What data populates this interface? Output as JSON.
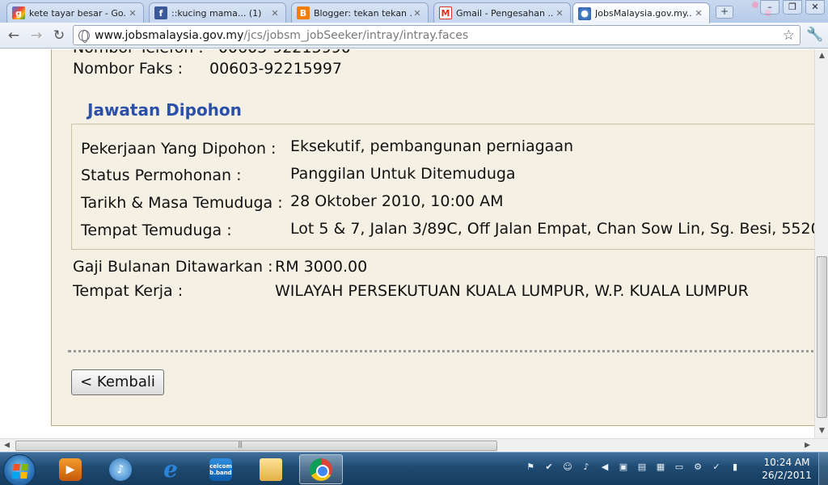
{
  "browser": {
    "tabs": [
      {
        "title": "kete tayar besar - Go...",
        "favicon": "google-icon"
      },
      {
        "title": "::kucing mama... (1)",
        "favicon": "facebook-icon"
      },
      {
        "title": "Blogger: tekan tekan ...",
        "favicon": "blogger-icon"
      },
      {
        "title": "Gmail - Pengesahan ...",
        "favicon": "gmail-icon"
      },
      {
        "title": "JobsMalaysia.gov.my...",
        "favicon": "jobsmalaysia-icon",
        "active": true
      }
    ],
    "url_host": "www.jobsmalaysia.gov.my",
    "url_path": "/jcs/jobsm_jobSeeker/intray/intray.faces"
  },
  "page": {
    "fax_label": "Nombor Faks :",
    "fax_value": "00603-92215997",
    "section_title": "Jawatan Dipohon",
    "job_applied_label": "Pekerjaan Yang Dipohon :",
    "job_applied_value": "Eksekutif, pembangunan perniagaan",
    "status_label": "Status Permohonan :",
    "status_value": "Panggilan Untuk Ditemuduga",
    "interview_datetime_label": "Tarikh & Masa Temuduga :",
    "interview_datetime_value": "28 Oktober 2010, 10:00 AM",
    "interview_place_label": "Tempat Temuduga :",
    "interview_place_value": "Lot 5 & 7, Jalan 3/89C, Off Jalan Empat, Chan Sow Lin, Sg. Besi, 5520",
    "salary_label": "Gaji Bulanan Ditawarkan :",
    "salary_value": "RM 3000.00",
    "workplace_label": "Tempat Kerja :",
    "workplace_value": "WILAYAH PERSEKUTUAN KUALA LUMPUR, W.P. KUALA LUMPUR",
    "back_button": "< Kembali"
  },
  "taskbar": {
    "time": "10:24 AM",
    "date": "26/2/2011"
  },
  "colors": {
    "section_title": "#2b50a8",
    "panel_bg": "#f4f1e4",
    "taskbar": "#1f4b73"
  }
}
